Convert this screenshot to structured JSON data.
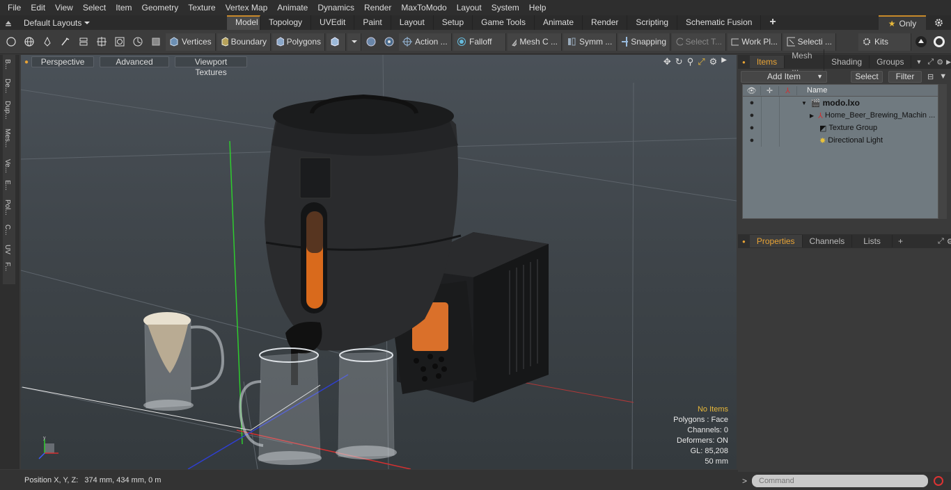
{
  "menu": [
    "File",
    "Edit",
    "View",
    "Select",
    "Item",
    "Geometry",
    "Texture",
    "Vertex Map",
    "Animate",
    "Dynamics",
    "Render",
    "MaxToModo",
    "Layout",
    "System",
    "Help"
  ],
  "layout_dropdown": "Default Layouts",
  "layout_tabs": [
    "Model",
    "Topology",
    "UVEdit",
    "Paint",
    "Layout",
    "Setup",
    "Game Tools",
    "Animate",
    "Render",
    "Scripting",
    "Schematic Fusion"
  ],
  "active_layout_tab": "Model",
  "only_label": "Only",
  "toolbar": {
    "vertices": "Vertices",
    "boundary": "Boundary",
    "polygons": "Polygons",
    "action": "Action ...",
    "falloff": "Falloff",
    "mesh_c": "Mesh C ...",
    "symm": "Symm ...",
    "snapping": "Snapping",
    "select_t": "Select T...",
    "work_pl": "Work Pl...",
    "selecti": "Selecti ...",
    "kits": "Kits"
  },
  "left_tabs": [
    "B...",
    "De...",
    "Dup...",
    "Mes...",
    "Ve...",
    "E...",
    "Pol...",
    "C...",
    "UV",
    "F..."
  ],
  "viewport": {
    "view_mode": "Perspective",
    "shading": "Advanced",
    "textures": "Viewport Textures",
    "stats": {
      "selection": "No Items",
      "polygons": "Polygons : Face",
      "channels": "Channels: 0",
      "deformers": "Deformers: ON",
      "gl": "GL: 85,208",
      "scale": "50 mm"
    }
  },
  "status": {
    "position": "Position X, Y, Z:   374 mm, 434 mm, 0 m"
  },
  "items_panel": {
    "tabs": [
      "Items",
      "Mesh ...",
      "Shading",
      "Groups"
    ],
    "add_item": "Add Item",
    "select": "Select",
    "filter": "Filter",
    "name_header": "Name",
    "tree": [
      {
        "label": "modo.lxo"
      },
      {
        "label": "Home_Beer_Brewing_Machin ..."
      },
      {
        "label": "Texture Group"
      },
      {
        "label": "Directional Light"
      }
    ]
  },
  "props_panel": {
    "tabs": [
      "Properties",
      "Channels",
      "Lists"
    ]
  },
  "command_placeholder": "Command",
  "colors": {
    "accent": "#e8a335",
    "viewport_top": "#4a5158",
    "viewport_bottom": "#343a3e",
    "tree_bg": "#707a80"
  }
}
